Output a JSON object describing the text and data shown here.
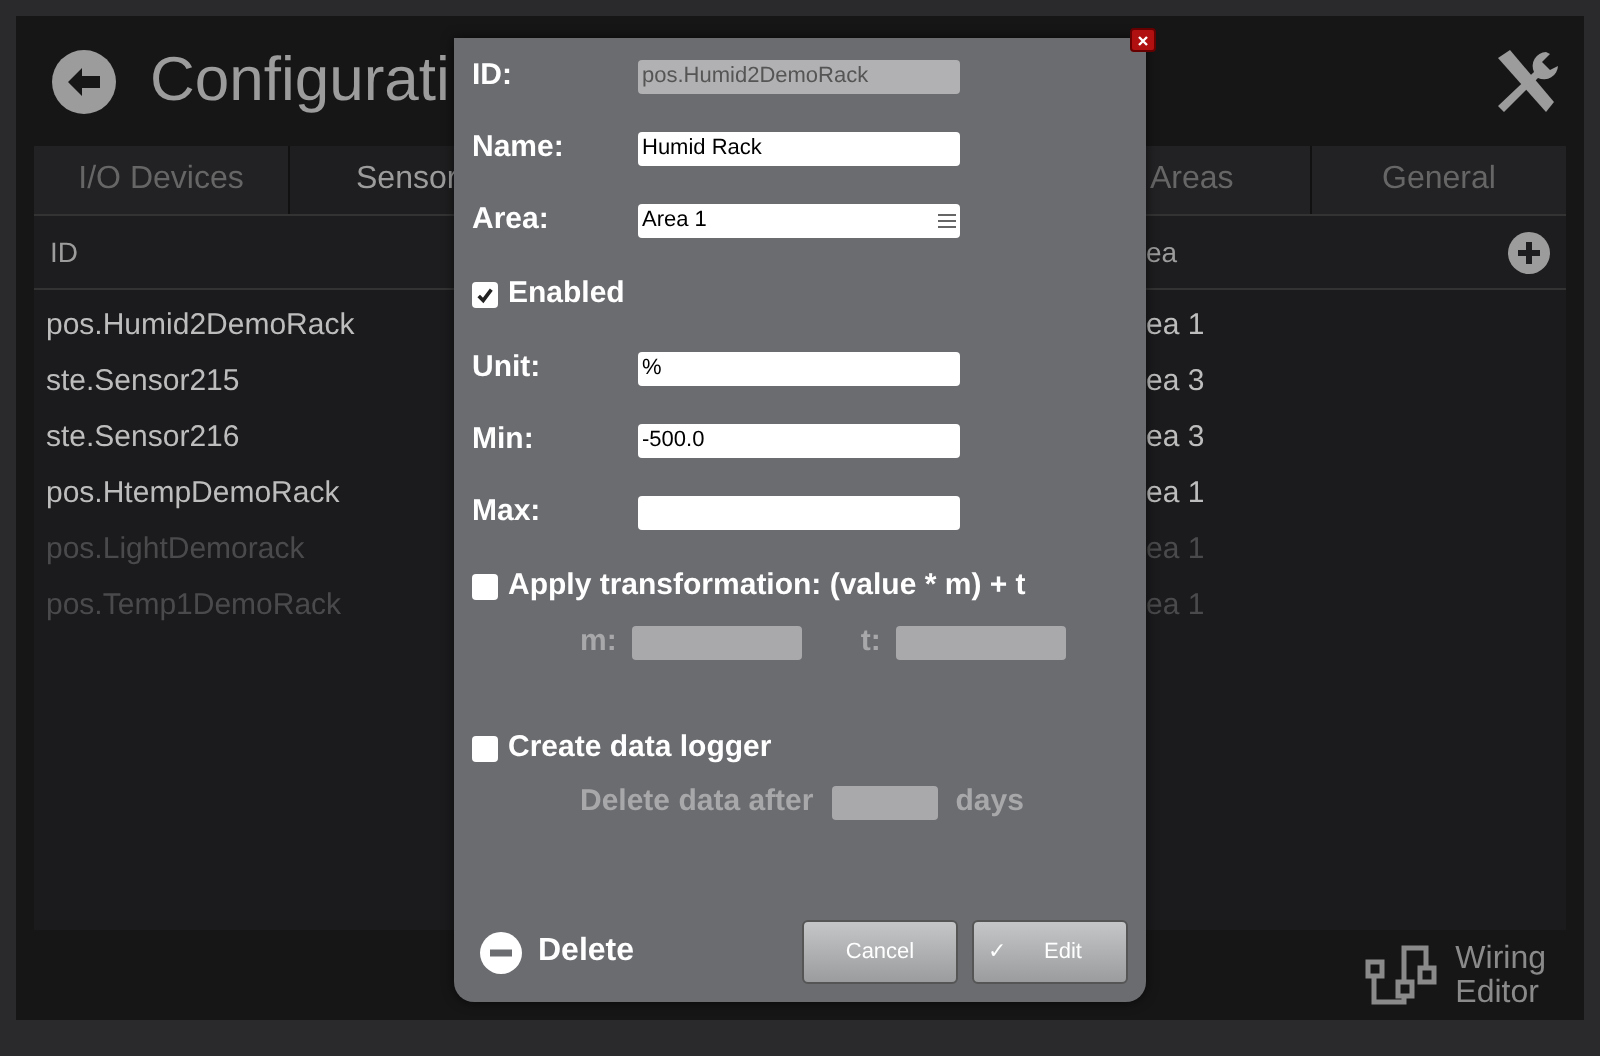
{
  "header": {
    "title": "Configurati"
  },
  "tabs": [
    {
      "label": "I/O Devices",
      "selected": false
    },
    {
      "label": "Sensor",
      "selected": true
    }
  ],
  "tabs_right": [
    {
      "label": "Areas",
      "selected": false
    },
    {
      "label": "General",
      "selected": false
    }
  ],
  "table": {
    "columns": [
      "ID",
      "ea"
    ],
    "rows": [
      {
        "id": "pos.Humid2DemoRack",
        "area": "ea 1",
        "disabled": false
      },
      {
        "id": "ste.Sensor215",
        "area": "ea 3",
        "disabled": false
      },
      {
        "id": "ste.Sensor216",
        "area": "ea 3",
        "disabled": false
      },
      {
        "id": "pos.HtempDemoRack",
        "area": "ea 1",
        "disabled": false
      },
      {
        "id": "pos.LightDemorack",
        "area": "ea 1",
        "disabled": true
      },
      {
        "id": "pos.Temp1DemoRack",
        "area": "ea 1",
        "disabled": true
      }
    ]
  },
  "footer": {
    "label_line1": "Wiring",
    "label_line2": "Editor"
  },
  "dialog": {
    "fields_top": [
      {
        "label": "ID:",
        "value": "pos.Humid2DemoRack",
        "kind": "readonly"
      },
      {
        "label": "Name:",
        "value": "Humid Rack",
        "kind": "text"
      },
      {
        "label": "Area:",
        "value": "Area 1",
        "kind": "select"
      }
    ],
    "enabled": {
      "label": "Enabled",
      "checked": true
    },
    "fields_bottom": [
      {
        "label": "Unit:",
        "value": "%",
        "kind": "text"
      },
      {
        "label": "Min:",
        "value": "-500.0",
        "kind": "text"
      },
      {
        "label": "Max:",
        "kind": "text"
      }
    ],
    "transformation": {
      "label": "Apply transformation: (value * m) + t",
      "checked": false,
      "m_label": "m:",
      "t_label": "t:"
    },
    "logger": {
      "label": "Create data logger",
      "checked": false,
      "prefix": "Delete data after",
      "suffix": "days"
    },
    "delete": "Delete",
    "cancel": "Cancel",
    "confirm": {
      "check": "✓",
      "label": "Edit"
    }
  }
}
